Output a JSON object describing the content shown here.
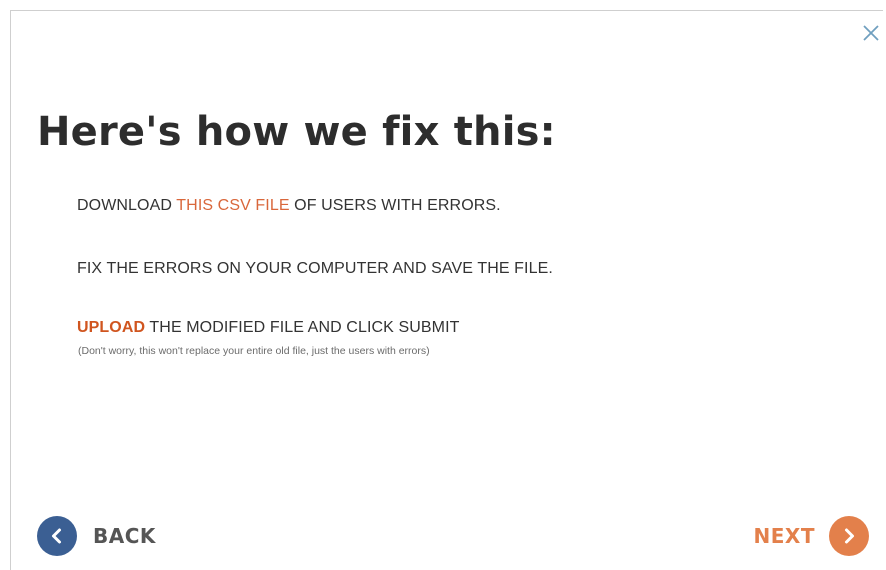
{
  "dialog": {
    "title": "Here's how we fix this:",
    "steps": [
      {
        "prefix": "DOWNLOAD ",
        "link": "THIS CSV FILE",
        "suffix": " OF USERS WITH ERRORS."
      },
      {
        "text": "FIX THE ERRORS ON YOUR COMPUTER AND SAVE THE FILE."
      },
      {
        "link": "UPLOAD",
        "suffix": " THE MODIFIED FILE AND CLICK SUBMIT"
      }
    ],
    "note": "(Don't worry, this won't replace your entire old file, just the users with errors)"
  },
  "nav": {
    "back_label": "BACK",
    "next_label": "NEXT"
  },
  "colors": {
    "accent": "#e3804b",
    "link": "#d9673b",
    "back_circle": "#3b5f93",
    "title": "#2d2d2d"
  },
  "icons": {
    "close": "close-icon",
    "back": "chevron-left-icon",
    "next": "chevron-right-icon"
  }
}
